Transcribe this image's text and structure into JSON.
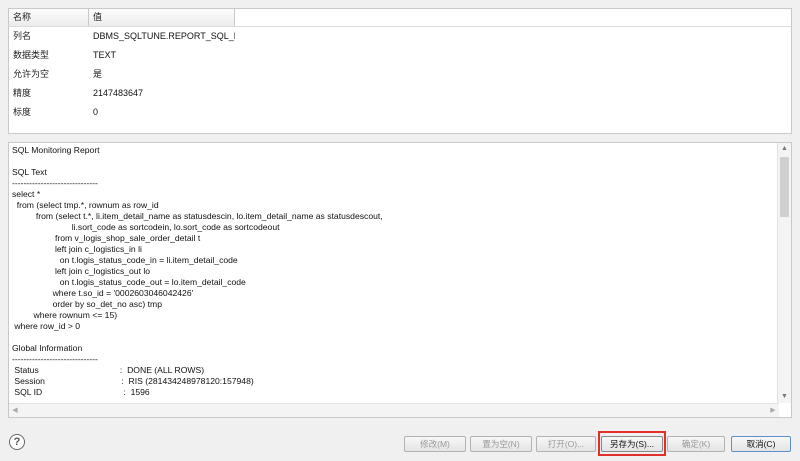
{
  "properties": {
    "headers": [
      "名称",
      "值"
    ],
    "rows": [
      {
        "name": "列名",
        "value": "DBMS_SQLTUNE.REPORT_SQL_MO"
      },
      {
        "name": "数据类型",
        "value": "TEXT"
      },
      {
        "name": "允许为空",
        "value": "是"
      },
      {
        "name": "精度",
        "value": "2147483647"
      },
      {
        "name": "标度",
        "value": "0"
      }
    ]
  },
  "report": {
    "text": "SQL Monitoring Report\n\nSQL Text\n------------------------------\nselect *\n  from (select tmp.*, rownum as row_id\n          from (select t.*, li.item_detail_name as statusdescin, lo.item_detail_name as statusdescout,\n                         li.sort_code as sortcodein, lo.sort_code as sortcodeout\n                  from v_logis_shop_sale_order_detail t\n                  left join c_logistics_in li\n                    on t.logis_status_code_in = li.item_detail_code\n                  left join c_logistics_out lo\n                    on t.logis_status_code_out = lo.item_detail_code\n                 where t.so_id = '0002603046042426'\n                 order by so_det_no asc) tmp\n         where rownum <= 15)\n where row_id > 0\n\nGlobal Information\n------------------------------\n Status                                  :  DONE (ALL ROWS)\n Session                                :  RIS (281434248978120:157948)\n SQL ID                                  :  1596"
  },
  "buttons": {
    "modify": "修改(M)",
    "set_null": "置为空(N)",
    "open": "打开(O)...",
    "save_as": "另存为(S)...",
    "ok": "确定(K)",
    "cancel": "取消(C)"
  },
  "help_icon": "?"
}
